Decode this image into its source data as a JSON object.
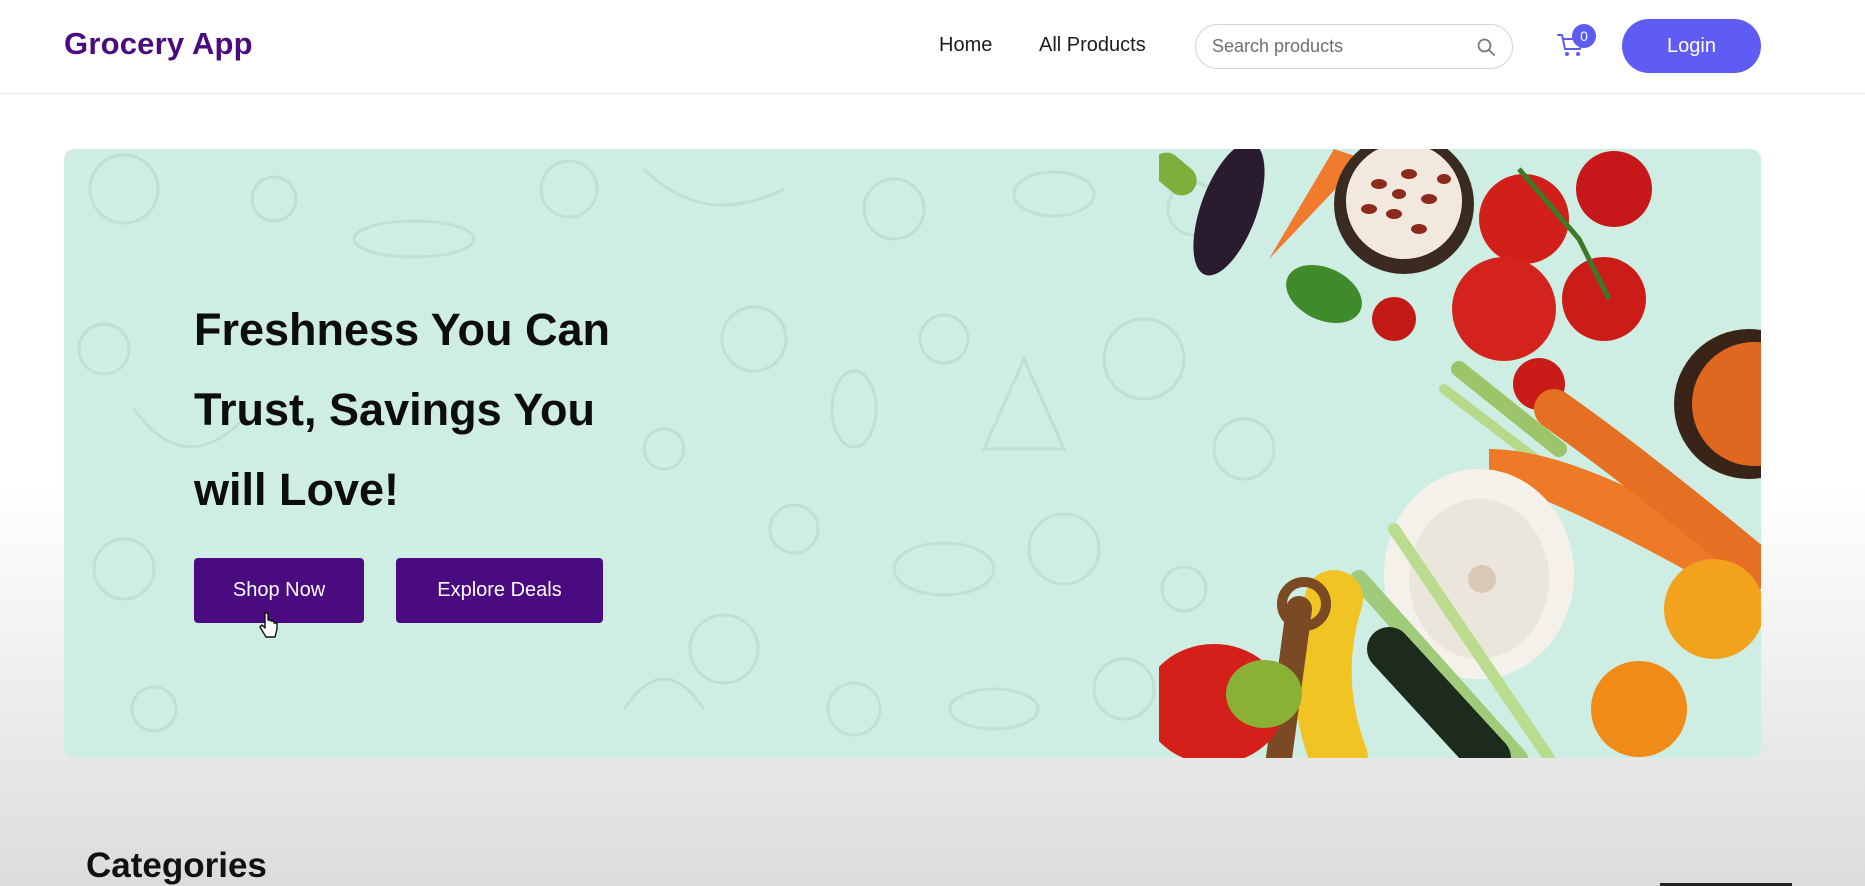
{
  "nav": {
    "logo": "Grocery App",
    "links": [
      "Home",
      "All Products"
    ],
    "search_placeholder": "Search products",
    "cart_count": "0",
    "login_label": "Login"
  },
  "hero": {
    "title_lines": [
      "Freshness You Can",
      "Trust, Savings You",
      "will Love!"
    ],
    "buttons": [
      "Shop Now",
      "Explore Deals"
    ]
  },
  "sections": {
    "categories_title": "Categories"
  },
  "colors": {
    "brand": "#4b0b7e",
    "accent": "#5e5cf3",
    "hero_bg": "#cfeee3",
    "hero_button": "#4a0b80"
  },
  "icons": [
    "search-icon",
    "cart-icon",
    "pointer-cursor-icon"
  ]
}
